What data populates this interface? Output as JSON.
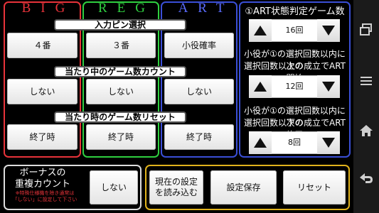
{
  "columns": {
    "big": {
      "title": "BIG",
      "color": "#e8333a"
    },
    "reg": {
      "title": "REG",
      "color": "#2fcf40"
    },
    "art": {
      "title": "ART",
      "color": "#3a4fd6"
    }
  },
  "sections": {
    "input_pin": {
      "title": "入力ピン選択",
      "values": [
        "４番",
        "３番",
        "小役確率"
      ]
    },
    "hit_count": {
      "title": "当たり中のゲーム数カウント",
      "values": [
        "しない",
        "しない",
        "しない"
      ]
    },
    "hit_reset": {
      "title": "当たり時のゲーム数リセット",
      "values": [
        "終了時",
        "終了時",
        "終了時"
      ]
    }
  },
  "right_panel": {
    "label1": "①ART状態判定ゲーム数",
    "spinner1": "16回",
    "label2_line1": "小役が①の選択回数以内に次の",
    "label2_line2": "選択回数以上の成立でART開始",
    "spinner2": "12回",
    "label3_line1": "小役が①の選択回数以内に次の",
    "label3_line2": "選択回数以下の成立でART終了",
    "spinner3": "8回"
  },
  "bonus": {
    "title_line1": "ボーナスの",
    "title_line2": "重複カウント",
    "note_line1": "※特殊仕様機を除き通常は",
    "note_line2": "「しない」に設定して下さい",
    "value": "しない"
  },
  "actions": {
    "load_line1": "現在の設定",
    "load_line2": "を読み込む",
    "save": "設定保存",
    "reset": "リセット"
  },
  "nav": {
    "icons": [
      "recent-apps-icon",
      "menu-icon",
      "home-icon",
      "back-icon"
    ]
  }
}
